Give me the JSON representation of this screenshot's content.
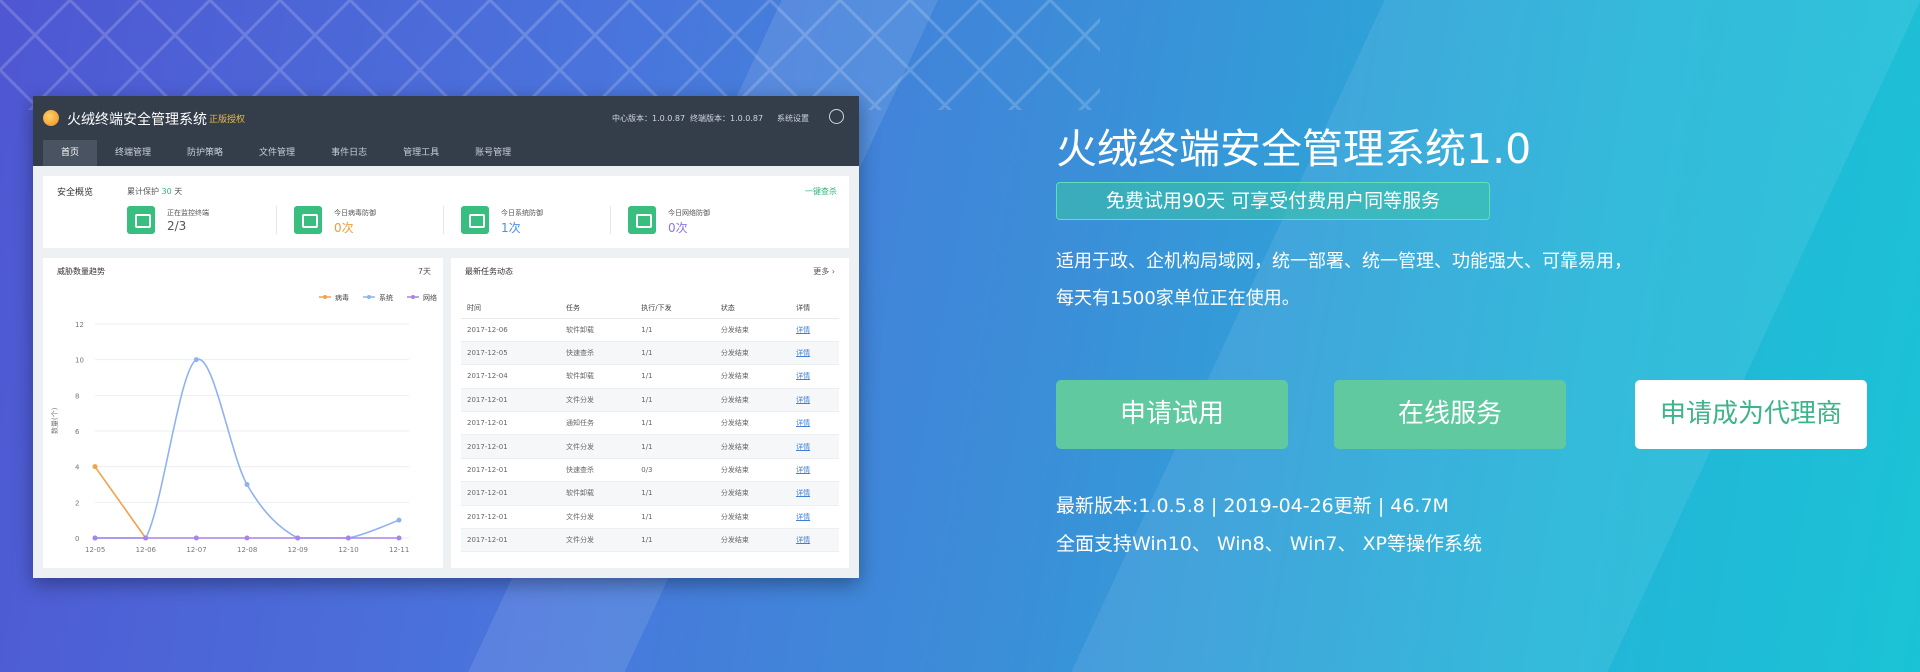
{
  "app": {
    "title": "火绒终端安全管理系统",
    "badge": "正版授权",
    "center_version": "中心版本：1.0.0.87",
    "endpoint_version": "终端版本：1.0.0.87",
    "settings": "系统设置",
    "nav": [
      "首页",
      "终端管理",
      "防护策略",
      "文件管理",
      "事件日志",
      "管理工具",
      "账号管理"
    ],
    "security": {
      "title": "安全概览",
      "days_prefix": "累计保护",
      "days_value": "30",
      "days_suffix": "天",
      "link": "一键查杀",
      "stats": [
        {
          "label": "正在监控终端",
          "value": "2/3",
          "color": "#555555"
        },
        {
          "label": "今日病毒防御",
          "value": "0次",
          "color": "#f29b38"
        },
        {
          "label": "今日系统防御",
          "value": "1次",
          "color": "#4a8ff0"
        },
        {
          "label": "今日网络防御",
          "value": "0次",
          "color": "#8b76e6"
        }
      ]
    },
    "chart_panel": {
      "title": "威胁数量趋势",
      "range": "7天"
    },
    "task_panel": {
      "title": "最新任务动态",
      "more": "更多",
      "columns": [
        "时间",
        "任务",
        "执行/下发",
        "状态",
        "详情"
      ],
      "rows": [
        [
          "2017-12-06",
          "软件卸载",
          "1/1",
          "分发结束",
          "详情"
        ],
        [
          "2017-12-05",
          "快速查杀",
          "1/1",
          "分发结束",
          "详情"
        ],
        [
          "2017-12-04",
          "软件卸载",
          "1/1",
          "分发结束",
          "详情"
        ],
        [
          "2017-12-01",
          "文件分发",
          "1/1",
          "分发结束",
          "详情"
        ],
        [
          "2017-12-01",
          "通知任务",
          "1/1",
          "分发结束",
          "详情"
        ],
        [
          "2017-12-01",
          "文件分发",
          "1/1",
          "分发结束",
          "详情"
        ],
        [
          "2017-12-01",
          "快速查杀",
          "0/3",
          "分发结束",
          "详情"
        ],
        [
          "2017-12-01",
          "软件卸载",
          "1/1",
          "分发结束",
          "详情"
        ],
        [
          "2017-12-01",
          "文件分发",
          "1/1",
          "分发结束",
          "详情"
        ],
        [
          "2017-12-01",
          "文件分发",
          "1/1",
          "分发结束",
          "详情"
        ]
      ]
    }
  },
  "chart_data": {
    "type": "line",
    "x": [
      "12-05",
      "12-06",
      "12-07",
      "12-08",
      "12-09",
      "12-10",
      "12-11"
    ],
    "ylabel": "数量(个)",
    "ylim": [
      0,
      12
    ],
    "yticks": [
      0,
      2,
      4,
      6,
      8,
      10,
      12
    ],
    "legend_position": "top-right",
    "grid": true,
    "series": [
      {
        "name": "病毒",
        "color": "#f5a04a",
        "values": [
          4,
          0,
          null,
          null,
          null,
          null,
          null
        ]
      },
      {
        "name": "系统",
        "color": "#8fb2f2",
        "values": [
          0,
          0,
          10,
          3,
          0,
          0,
          1
        ]
      },
      {
        "name": "网络",
        "color": "#a883e8",
        "values": [
          0,
          0,
          0,
          0,
          0,
          0,
          0
        ]
      }
    ]
  },
  "promo": {
    "title": "火绒终端安全管理系统1.0",
    "tag": "免费试用90天  可享受付费用户同等服务",
    "desc1": "适用于政、企机构局域网，统一部署、统一管理、功能强大、可靠易用，",
    "desc2": "每天有1500家单位正在使用。",
    "btn_trial": "申请试用",
    "btn_service": "在线服务",
    "btn_agent": "申请成为代理商",
    "version_line": "最新版本:1.0.5.8 | 2019-04-26更新 | 46.7M",
    "os_line": "全面支持Win10、 Win8、 Win7、 XP等操作系统"
  }
}
